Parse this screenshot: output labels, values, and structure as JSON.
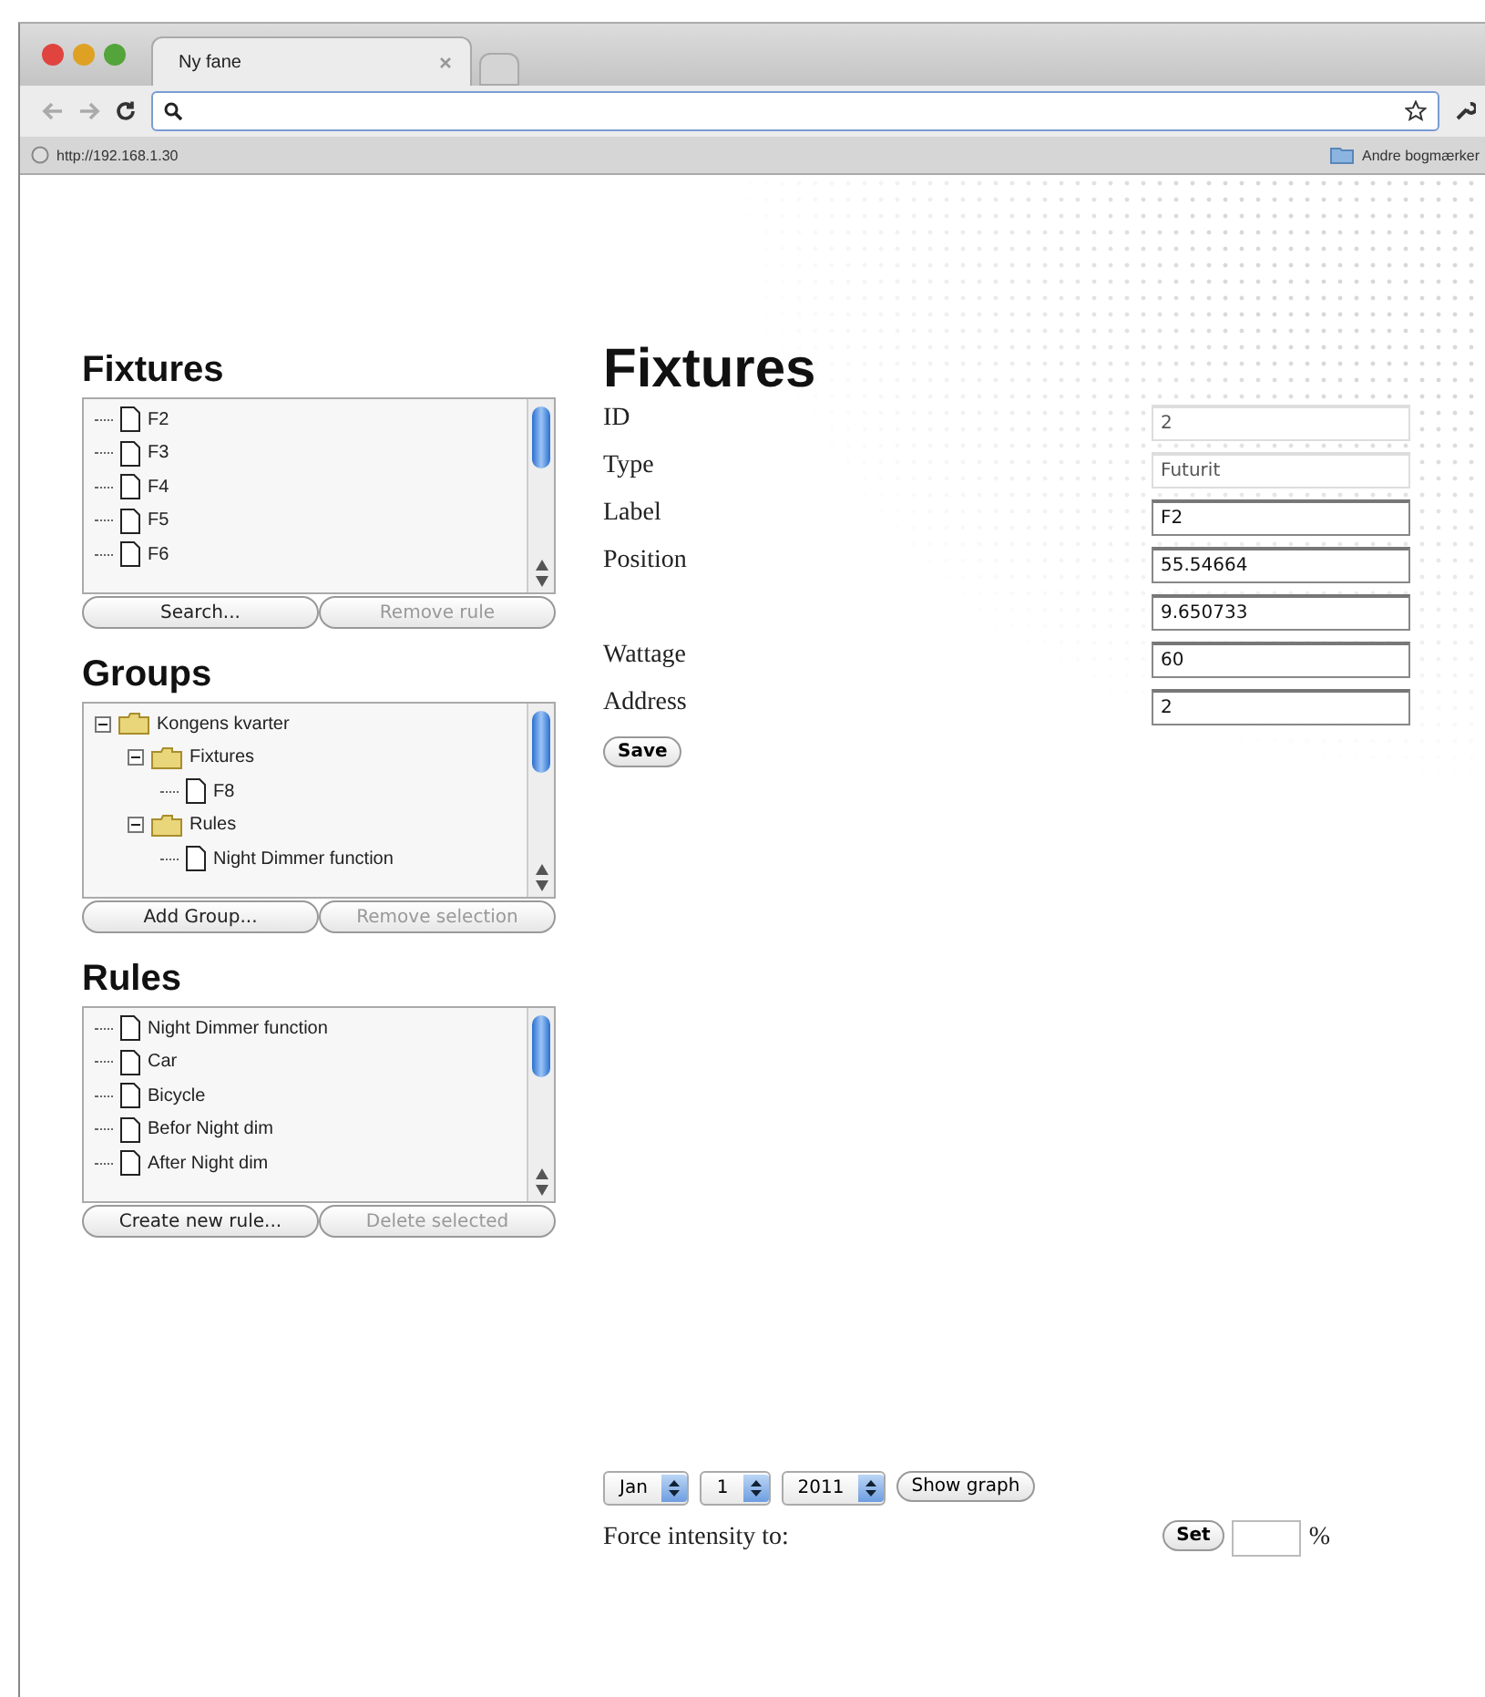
{
  "browser": {
    "tabs": [
      {
        "label": "Ny fane",
        "selected": true,
        "kind": "page"
      },
      {
        "selected": false,
        "kind": "new"
      }
    ],
    "status_url": "http://192.168.1.30",
    "bookmark": "Andre bogmærker"
  },
  "sidebar": [
    {
      "title": "Fixtures",
      "items": [
        {
          "label": "F2",
          "kind": "file"
        },
        {
          "label": "F3",
          "kind": "file"
        },
        {
          "label": "F4",
          "kind": "file"
        },
        {
          "label": "F5",
          "kind": "file"
        },
        {
          "label": "F6",
          "kind": "file"
        }
      ],
      "buttons": [
        {
          "label": "Search...",
          "disabled": false
        },
        {
          "label": "Remove rule",
          "disabled": true
        }
      ]
    },
    {
      "title": "Groups",
      "items": [
        {
          "label": "Kongens kvarter",
          "kind": "folder",
          "expanded": true,
          "children": [
            {
              "label": "Fixtures",
              "kind": "folder",
              "expanded": true,
              "children": [
                {
                  "label": "F8",
                  "kind": "file"
                }
              ]
            },
            {
              "label": "Rules",
              "kind": "folder",
              "expanded": true,
              "children": [
                {
                  "label": "Night Dimmer function",
                  "kind": "file"
                }
              ]
            }
          ]
        }
      ],
      "buttons": [
        {
          "label": "Add Group...",
          "disabled": false
        },
        {
          "label": "Remove selection",
          "disabled": true
        }
      ]
    },
    {
      "title": "Rules",
      "items": [
        {
          "label": "Night Dimmer function",
          "kind": "file"
        },
        {
          "label": "Car",
          "kind": "file"
        },
        {
          "label": "Bicycle",
          "kind": "file"
        },
        {
          "label": "Befor Night dim",
          "kind": "file"
        },
        {
          "label": "After Night dim",
          "kind": "file"
        }
      ],
      "buttons": [
        {
          "label": "Create new rule...",
          "disabled": false
        },
        {
          "label": "Delete selected",
          "disabled": true
        }
      ]
    }
  ],
  "form": {
    "title": "Fixtures",
    "fields": [
      {
        "label": "ID",
        "values": [
          "2"
        ],
        "disabled": true
      },
      {
        "label": "Type",
        "values": [
          "Futurit"
        ],
        "disabled": true
      },
      {
        "label": "Label",
        "values": [
          "F2"
        ],
        "disabled": false
      },
      {
        "label": "Position",
        "values": [
          "55.54664",
          "9.650733"
        ],
        "disabled": false
      },
      {
        "label": "Wattage",
        "values": [
          "60"
        ],
        "disabled": false
      },
      {
        "label": "Address",
        "values": [
          "2"
        ],
        "disabled": false
      }
    ],
    "save": "Save"
  },
  "graph": {
    "selects": [
      "Jan",
      "1",
      "2011"
    ],
    "button": "Show graph"
  },
  "force": {
    "label": "Force intensity to:",
    "button": "Set",
    "unit": "%"
  }
}
